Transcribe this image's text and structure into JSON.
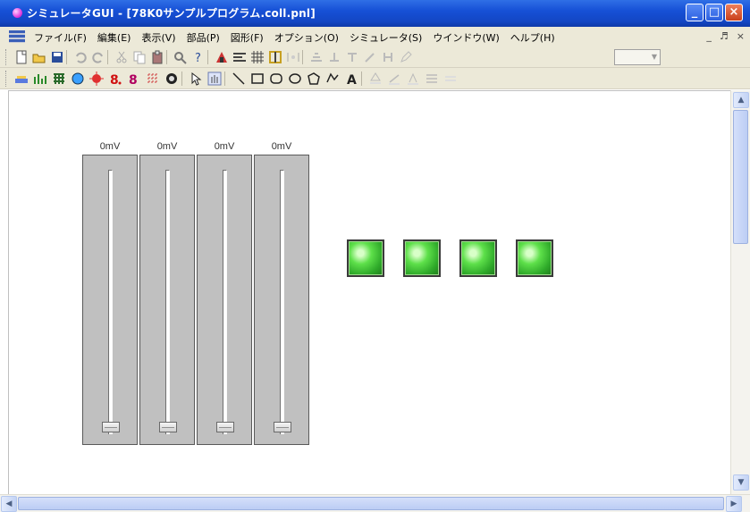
{
  "window": {
    "title": "シミュレータGUI - [78K0サンプルプログラム.coll.pnl]",
    "min_label": "_",
    "max_label": "□",
    "close_label": "×"
  },
  "menu": {
    "items": [
      "ファイル(F)",
      "編集(E)",
      "表示(V)",
      "部品(P)",
      "図形(F)",
      "オプション(O)",
      "シミュレータ(S)",
      "ウインドウ(W)",
      "ヘルプ(H)"
    ],
    "mdi_min": "_",
    "mdi_restore": "♬",
    "mdi_close": "×"
  },
  "toolbar1": {
    "tools": [
      "new-icon",
      "open-icon",
      "save-icon",
      "undo-icon",
      "redo-icon",
      "cut-icon",
      "copy-icon",
      "paste-icon",
      "find-icon",
      "help-icon",
      "properties-icon",
      "align-icon",
      "grid-icon",
      "snap-icon",
      "group-icon",
      "layer-icon",
      "bring-front-icon",
      "send-back-icon",
      "rotate-icon",
      "flip-icon",
      "pen-icon"
    ]
  },
  "toolbar2": {
    "tools": [
      "button-part-icon",
      "level-part-icon",
      "matrix-part-icon",
      "led-part-icon",
      "lamp-part-icon",
      "segment-part-icon",
      "dot-part-icon",
      "buzzer-part-icon",
      "key-part-icon",
      "select-arrow-icon",
      "hand-icon",
      "line-icon",
      "rectangle-icon",
      "rounded-rect-icon",
      "ellipse-icon",
      "polygon-icon",
      "freeform-icon",
      "text-icon",
      "fill-icon",
      "line-color-icon",
      "text-color-icon",
      "line-style-icon",
      "arrow-style-icon"
    ]
  },
  "faders": [
    {
      "label": "0mV",
      "level": 0
    },
    {
      "label": "0mV",
      "level": 0
    },
    {
      "label": "0mV",
      "level": 0
    },
    {
      "label": "0mV",
      "level": 0
    }
  ],
  "leds": [
    {
      "state": "on",
      "color": "#3fcf33"
    },
    {
      "state": "on",
      "color": "#3fcf33"
    },
    {
      "state": "on",
      "color": "#3fcf33"
    },
    {
      "state": "on",
      "color": "#3fcf33"
    }
  ],
  "scroll": {
    "up": "▲",
    "down": "▼",
    "left": "◀",
    "right": "▶"
  }
}
